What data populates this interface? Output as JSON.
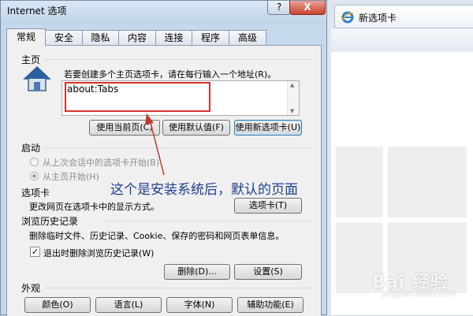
{
  "browser": {
    "tab_label": "新选项卡"
  },
  "dialog": {
    "title": "Internet 选项",
    "help_label": "?",
    "close_label": "X",
    "tabs": [
      "常规",
      "安全",
      "隐私",
      "内容",
      "连接",
      "程序",
      "高级"
    ],
    "home": {
      "group_label": "主页",
      "instruction": "若要创建多个主页选项卡，请在每行输入一个地址(R)。",
      "url_value": "about:Tabs",
      "buttons": [
        "使用当前页(C)",
        "使用默认值(F)",
        "使用新选项卡(U)"
      ]
    },
    "startup": {
      "group_label": "启动",
      "options": [
        "从上次会话中的选项卡开始(B)",
        "从主页开始(H)"
      ],
      "selected_index": 1
    },
    "tabs_section": {
      "group_label": "选项卡",
      "description": "更改网页在选项卡中的显示方式。",
      "button": "选项卡(T)"
    },
    "history": {
      "group_label": "浏览历史记录",
      "description": "删除临时文件、历史记录、Cookie、保存的密码和网页表单信息。",
      "checkbox_label": "退出时删除浏览历史记录(W)",
      "checkbox_checked": true,
      "buttons": [
        "删除(D)...",
        "设置(S)"
      ]
    },
    "appearance": {
      "group_label": "外观",
      "buttons": [
        "颜色(O)",
        "语言(L)",
        "字体(N)",
        "辅助功能(E)"
      ]
    }
  },
  "annotation": {
    "text": "这个是安装系统后，默认的页面",
    "color": "#1f3f8f",
    "highlight_color": "#d9302b"
  },
  "watermark": {
    "text": "Bai 经验",
    "sub": "jingyan.baidu.com"
  }
}
